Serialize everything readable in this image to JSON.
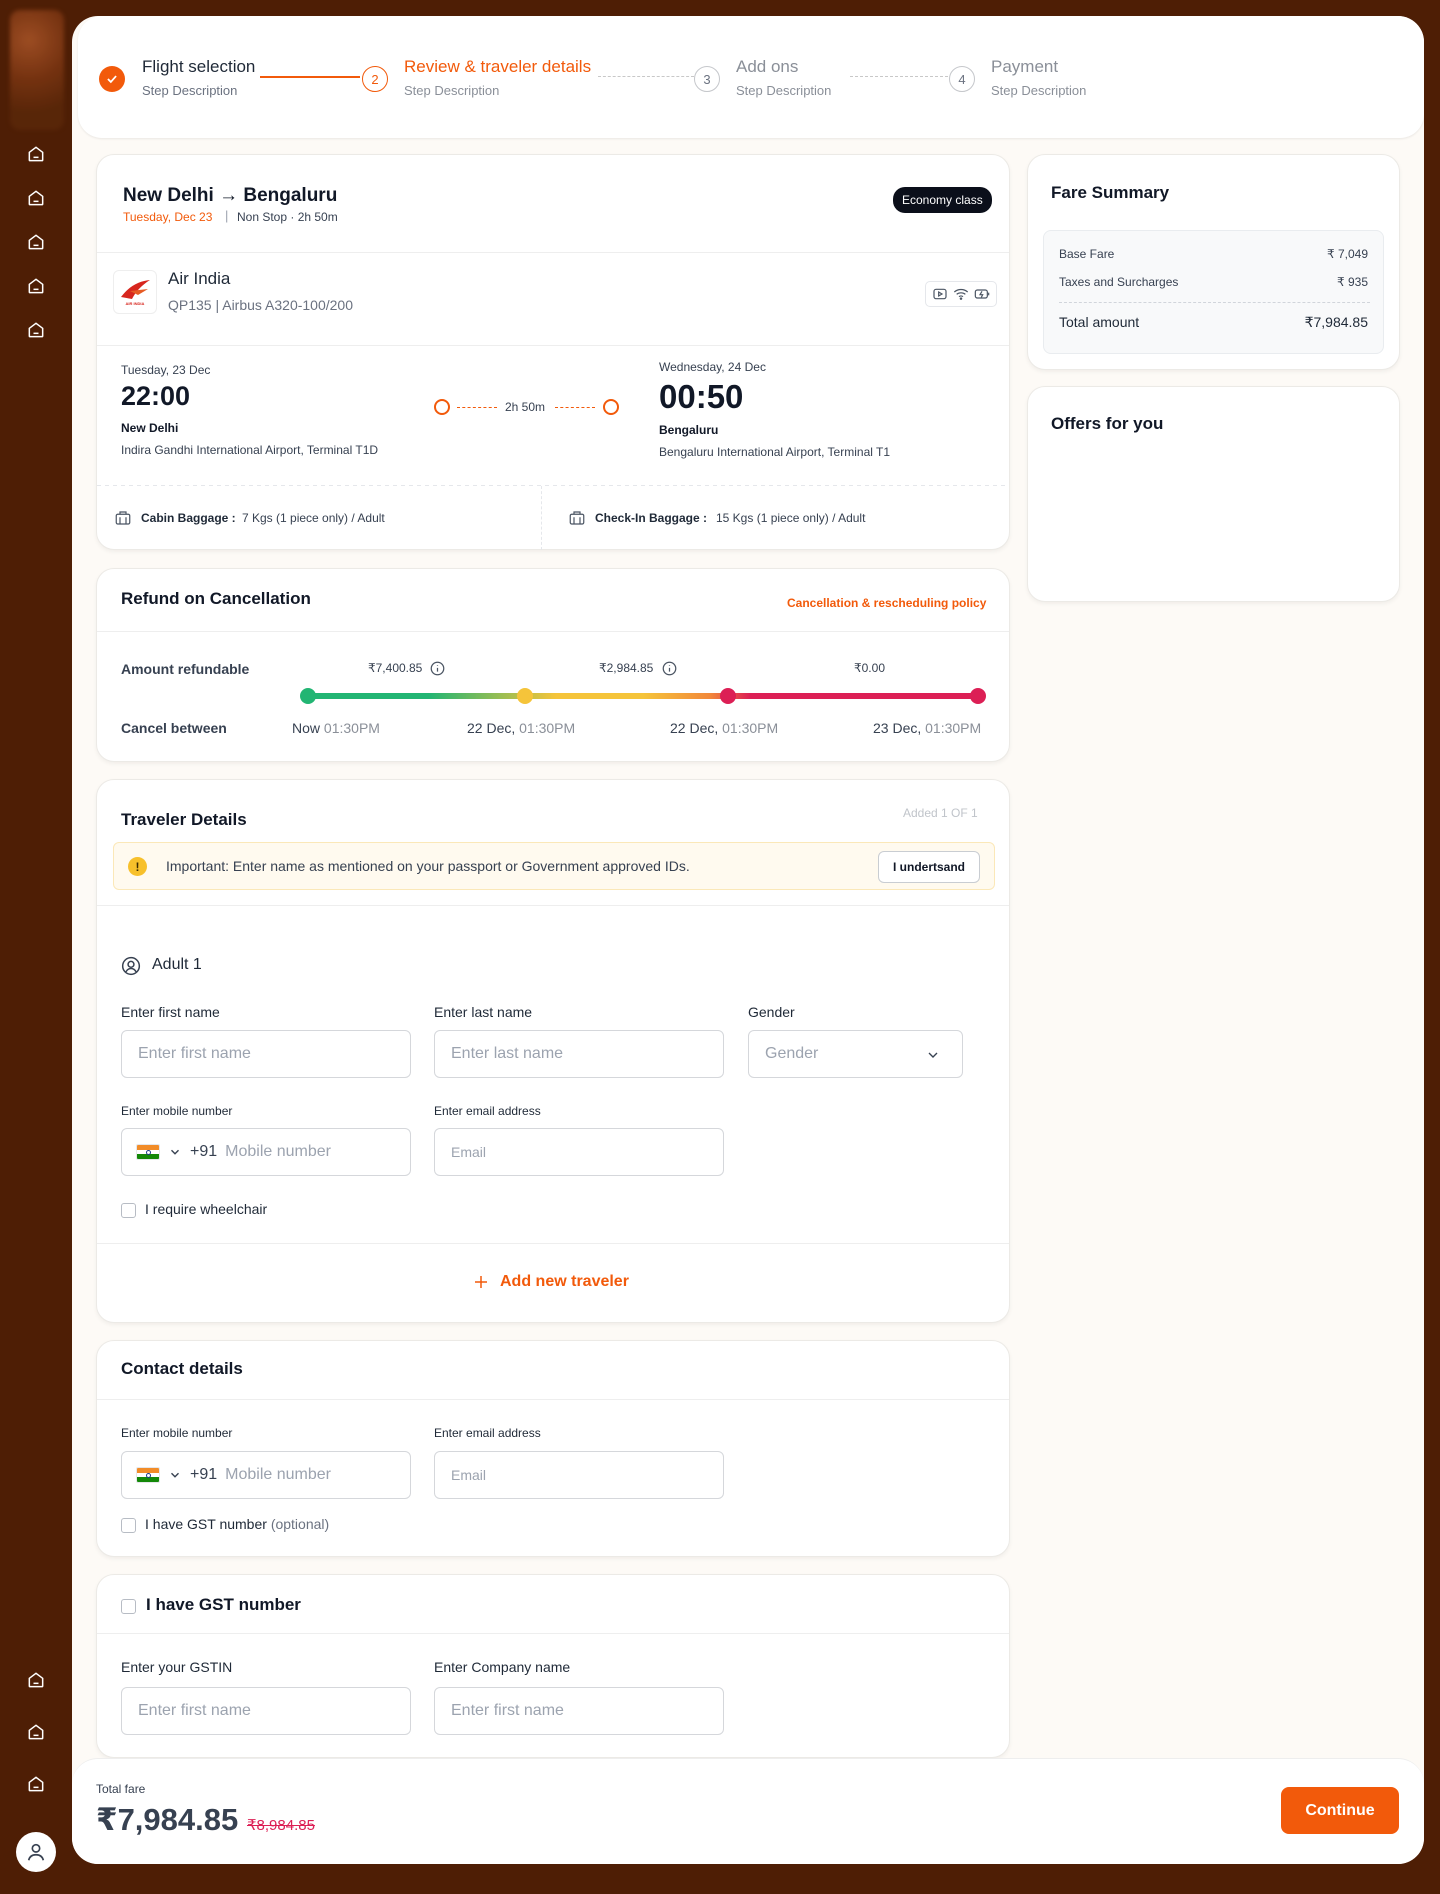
{
  "stepper": {
    "steps": [
      {
        "number": "",
        "title": "Flight selection",
        "description": "Step Description",
        "state": "completed"
      },
      {
        "number": "2",
        "title": "Review & traveler details",
        "description": "Step Description",
        "state": "active"
      },
      {
        "number": "3",
        "title": "Add ons",
        "description": "Step Description",
        "state": "pending"
      },
      {
        "number": "4",
        "title": "Payment",
        "description": "Step Description",
        "state": "pending"
      }
    ]
  },
  "flight": {
    "route": "New Delhi → Bengaluru",
    "date": "Tuesday, Dec 23",
    "separator": "|",
    "stops_duration": "Non Stop · 2h 50m",
    "class_badge": "Economy class",
    "airline": "Air India",
    "airline_logo_text": "AIR INDIA",
    "flight_info": "QP135 | Airbus A320-100/200",
    "departure": {
      "date": "Tuesday, 23 Dec",
      "time": "22:00",
      "city": "New Delhi",
      "airport": "Indira Gandhi International Airport, Terminal T1D"
    },
    "arrival": {
      "date": "Wednesday, 24 Dec",
      "time": "00:50",
      "city": "Bengaluru",
      "airport": "Bengaluru International Airport, Terminal T1"
    },
    "duration": "2h 50m",
    "cabin_baggage_label": "Cabin Baggage :",
    "cabin_baggage_value": "7 Kgs (1 piece only) / Adult",
    "checkin_baggage_label": "Check-In Baggage :",
    "checkin_baggage_value": "15 Kgs (1 piece only) / Adult",
    "amenities": [
      "media-icon",
      "wifi-icon",
      "power-icon"
    ]
  },
  "refund": {
    "title": "Refund on Cancellation",
    "policy_link": "Cancellation & rescheduling policy",
    "amount_label": "Amount refundable",
    "cancel_label": "Cancel between",
    "amounts": [
      "₹7,400.85",
      "₹2,984.85",
      "₹0.00"
    ],
    "times": [
      {
        "day": "Now",
        "time": "01:30PM"
      },
      {
        "day": "22 Dec,",
        "time": "01:30PM"
      },
      {
        "day": "22 Dec,",
        "time": "01:30PM"
      },
      {
        "day": "23 Dec,",
        "time": "01:30PM"
      }
    ],
    "colors": {
      "green": "#22b573",
      "yellow": "#f5c43a",
      "red": "#dc1f55"
    }
  },
  "traveler": {
    "title": "Traveler Details",
    "added_count": "Added 1  OF  1",
    "notice": "Important: Enter name as mentioned on your passport or Government approved IDs.",
    "notice_button": "I undertsand",
    "adult_label": "Adult 1",
    "first_name_label": "Enter first name",
    "first_name_placeholder": "Enter first name",
    "last_name_label": "Enter last name",
    "last_name_placeholder": "Enter last name",
    "gender_label": "Gender",
    "gender_placeholder": "Gender",
    "mobile_label": "Enter mobile number",
    "country_code": "+91",
    "mobile_placeholder": "Mobile number",
    "email_label": "Enter email address",
    "email_placeholder": "Email",
    "wheelchair_label": "I require wheelchair",
    "add_traveler": "Add new traveler"
  },
  "contact": {
    "title": "Contact details",
    "mobile_label": "Enter mobile number",
    "country_code": "+91",
    "mobile_placeholder": "Mobile number",
    "email_label": "Enter email address",
    "email_placeholder": "Email",
    "gst_label": "I have GST number",
    "gst_optional": "(optional)"
  },
  "gst": {
    "title": "I have GST number",
    "gstin_label": "Enter your GSTIN",
    "gstin_placeholder": "Enter first name",
    "company_label": "Enter Company name",
    "company_placeholder": "Enter first name"
  },
  "fare_summary": {
    "title": "Fare Summary",
    "rows": [
      {
        "label": "Base Fare",
        "value": "₹ 7,049"
      },
      {
        "label": "Taxes and Surcharges",
        "value": "₹ 935"
      }
    ],
    "total_label": "Total amount",
    "total_value": "₹7,984.85"
  },
  "offers": {
    "title": "Offers for you"
  },
  "footer": {
    "total_label": "Total fare",
    "total": "₹7,984.85",
    "original": "₹8,984.85",
    "continue": "Continue"
  },
  "colors": {
    "accent": "#f25a0b",
    "dark": "#0b0f1a",
    "strike": "#dc1f55"
  }
}
